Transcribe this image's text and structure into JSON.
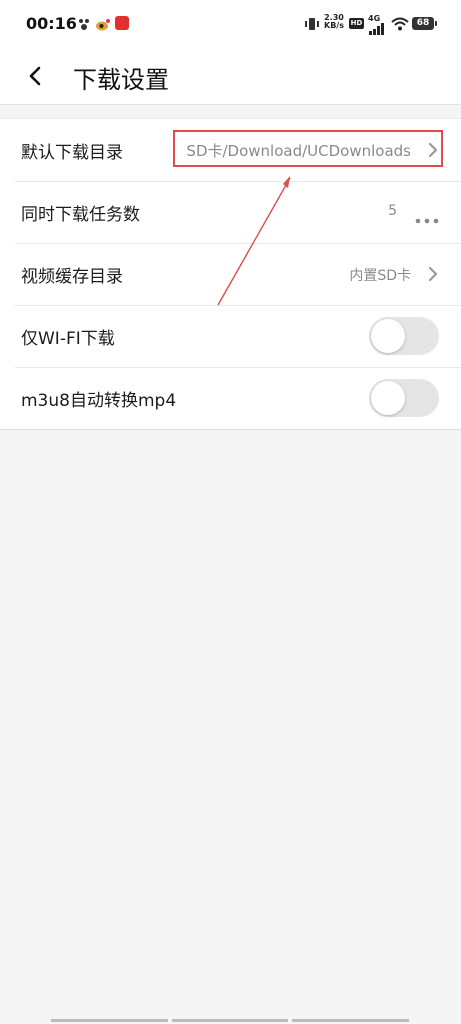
{
  "status_bar": {
    "time": "00:16",
    "network_speed_value": "2.30",
    "network_speed_unit": "KB/s",
    "hd_label": "HD",
    "signal_label": "4G",
    "battery_level": "68"
  },
  "header": {
    "title": "下载设置"
  },
  "settings": {
    "default_dir": {
      "label": "默认下载目录",
      "value": "SD卡/Download/UCDownloads"
    },
    "concurrent_tasks": {
      "label": "同时下载任务数",
      "value": "5"
    },
    "video_cache_dir": {
      "label": "视频缓存目录",
      "value": "内置SD卡"
    },
    "wifi_only": {
      "label": "仅WI-FI下载",
      "enabled": false
    },
    "m3u8_convert": {
      "label": "m3u8自动转换mp4",
      "enabled": false
    }
  },
  "colors": {
    "annotation_red": "#e04b4b",
    "toggle_off": "#e5e5e5"
  }
}
